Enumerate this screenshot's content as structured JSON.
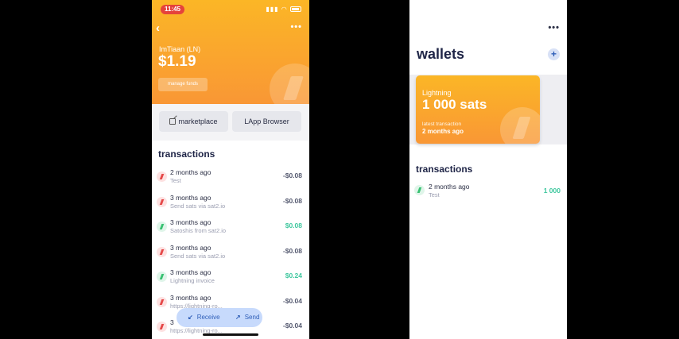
{
  "left": {
    "status": {
      "time": "11:45"
    },
    "wallet": {
      "name": "ImTiaan (LN)",
      "balance": "$1.19",
      "manage_label": "manage funds"
    },
    "actions": {
      "marketplace": "marketplace",
      "lapp_browser": "LApp Browser"
    },
    "transactions_heading": "transactions",
    "transactions": [
      {
        "date": "2 months ago",
        "memo": "Test",
        "amount": "-$0.08",
        "direction": "out"
      },
      {
        "date": "3 months ago",
        "memo": "Send sats via sat2.io",
        "amount": "-$0.08",
        "direction": "out"
      },
      {
        "date": "3 months ago",
        "memo": "Satoshis from sat2.io",
        "amount": "$0.08",
        "direction": "in"
      },
      {
        "date": "3 months ago",
        "memo": "Send sats via sat2.io",
        "amount": "-$0.08",
        "direction": "out"
      },
      {
        "date": "3 months ago",
        "memo": "Lightning invoice",
        "amount": "$0.24",
        "direction": "in"
      },
      {
        "date": "3 months ago",
        "memo": "https://lightning-ro...",
        "amount": "-$0.04",
        "direction": "out"
      },
      {
        "date": "3",
        "memo": "https://lightning-ro...",
        "amount": "-$0.04",
        "direction": "out"
      }
    ],
    "fab": {
      "receive": "Receive",
      "send": "Send"
    }
  },
  "right": {
    "title": "wallets",
    "add_label": "+",
    "card": {
      "name": "Lightning",
      "balance": "1 000 sats",
      "latest_label": "latest transaction",
      "latest_value": "2 months ago"
    },
    "transactions_heading": "transactions",
    "transactions": [
      {
        "date": "2 months ago",
        "memo": "Test",
        "amount": "1 000",
        "direction": "in"
      }
    ]
  },
  "colors": {
    "accent_gradient_top": "#fbb626",
    "accent_gradient_bottom": "#f99735",
    "incoming": "#3ec79e",
    "outgoing": "#555a70",
    "heading": "#1f2547",
    "fab_bg": "#c7dafc"
  },
  "icons": {
    "back": "chevron-left-icon",
    "more": "more-horizontal-icon",
    "external": "external-link-icon",
    "tx": "lightning-bolt-icon",
    "receive": "arrow-down-left-icon",
    "send": "arrow-up-right-icon",
    "add": "plus-icon"
  }
}
